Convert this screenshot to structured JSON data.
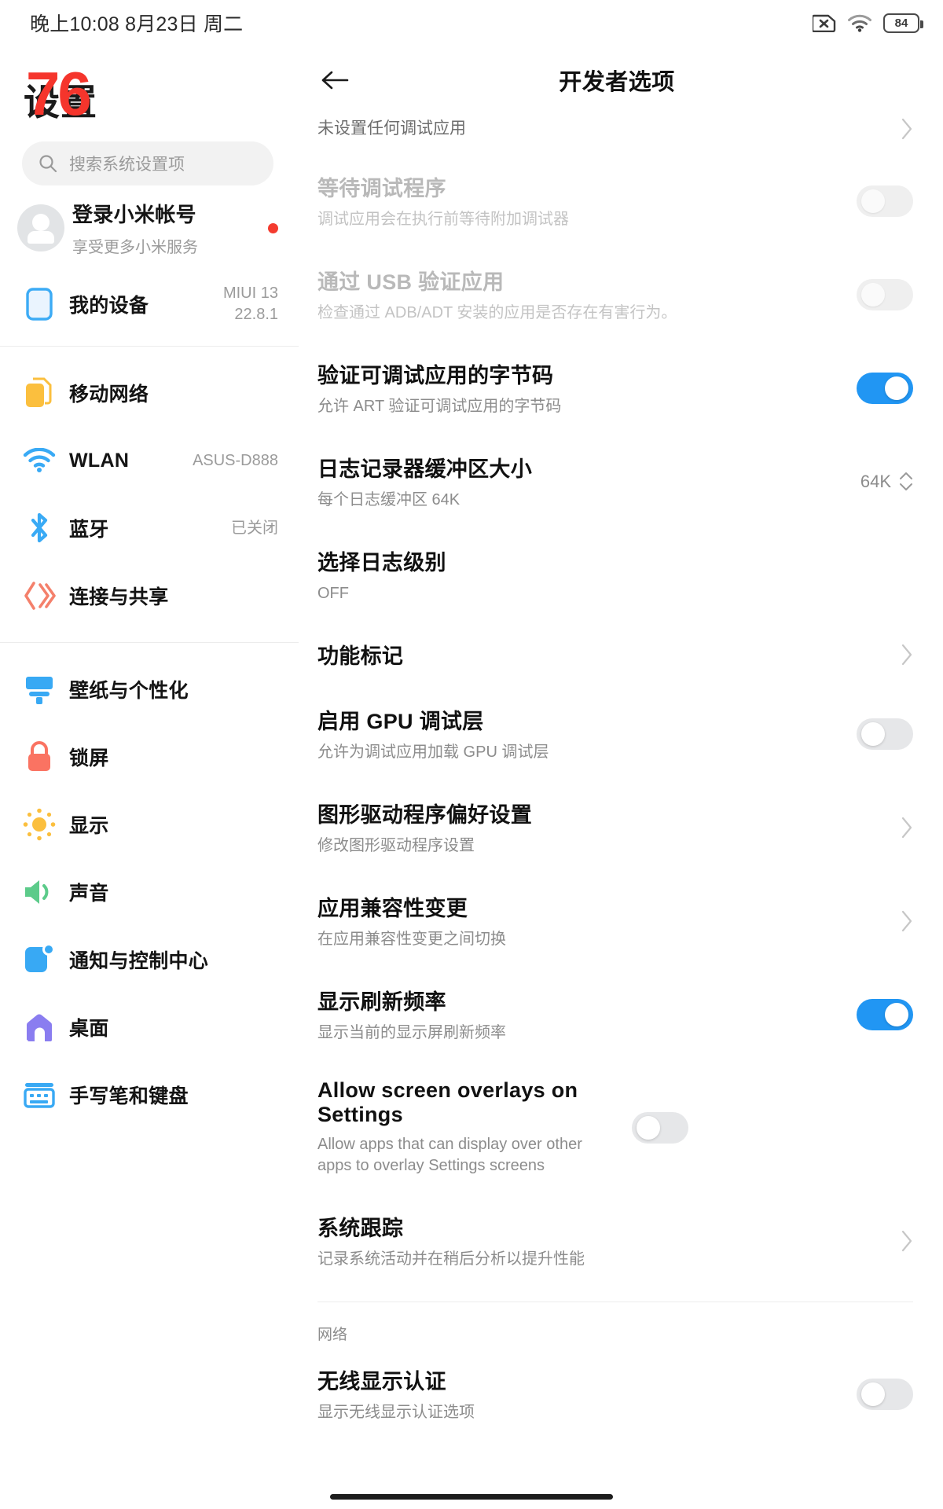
{
  "statusbar": {
    "time": "晚上10:08  8月23日 周二",
    "battery_percent": "84",
    "icons": [
      "sim-disabled-icon",
      "wifi-icon",
      "battery-icon"
    ]
  },
  "sidebar": {
    "app_title": "设置",
    "watermark": "76",
    "search": {
      "placeholder": "搜索系统设置项",
      "icon": "search-icon"
    },
    "account": {
      "title": "登录小米帐号",
      "subtitle": "享受更多小米服务",
      "avatar": "person-avatar-icon",
      "badge": true
    },
    "device": {
      "title": "我的设备",
      "value_line1": "MIUI 13",
      "value_line2": "22.8.1",
      "icon": "device-icon"
    },
    "groups": [
      {
        "items": [
          {
            "label": "移动网络",
            "value": "",
            "icon": "sim-card-icon",
            "color": "#fbbf3e"
          },
          {
            "label": "WLAN",
            "value": "ASUS-D888",
            "icon": "wifi-icon",
            "color": "#39aaf5"
          },
          {
            "label": "蓝牙",
            "value": "已关闭",
            "icon": "bluetooth-icon",
            "color": "#39aaf5"
          },
          {
            "label": "连接与共享",
            "value": "",
            "icon": "share-icon",
            "color": "#f4806b"
          }
        ]
      },
      {
        "items": [
          {
            "label": "壁纸与个性化",
            "value": "",
            "icon": "wallpaper-icon",
            "color": "#38a9f4"
          },
          {
            "label": "锁屏",
            "value": "",
            "icon": "lock-icon",
            "color": "#fa7362"
          },
          {
            "label": "显示",
            "value": "",
            "icon": "brightness-icon",
            "color": "#fbbf3e"
          },
          {
            "label": "声音",
            "value": "",
            "icon": "speaker-icon",
            "color": "#5ccb8a"
          },
          {
            "label": "通知与控制中心",
            "value": "",
            "icon": "notification-icon",
            "color": "#38a9f4"
          },
          {
            "label": "桌面",
            "value": "",
            "icon": "home-icon",
            "color": "#8a7df0"
          },
          {
            "label": "手写笔和键盘",
            "value": "",
            "icon": "keyboard-icon",
            "color": "#38a9f4"
          }
        ]
      }
    ]
  },
  "detail": {
    "title": "开发者选项",
    "back_icon": "arrow-left-icon",
    "items": [
      {
        "title": "",
        "subtitle": "未设置任何调试应用",
        "control": "chevron",
        "dim": false,
        "clipped_top": true
      },
      {
        "title": "等待调试程序",
        "subtitle": "调试应用会在执行前等待附加调试器",
        "control": "switch",
        "switch_on": false,
        "dim": true
      },
      {
        "title": "通过 USB 验证应用",
        "subtitle": "检查通过 ADB/ADT 安装的应用是否存在有害行为。",
        "control": "switch",
        "switch_on": false,
        "dim": true
      },
      {
        "title": "验证可调试应用的字节码",
        "subtitle": "允许 ART 验证可调试应用的字节码",
        "control": "switch",
        "switch_on": true,
        "dim": false
      },
      {
        "title": "日志记录器缓冲区大小",
        "subtitle": "每个日志缓冲区 64K",
        "control": "stepper",
        "value": "64K",
        "dim": false
      },
      {
        "title": "选择日志级别",
        "subtitle": "OFF",
        "control": "none",
        "dim": false
      },
      {
        "title": "功能标记",
        "subtitle": "",
        "control": "chevron",
        "dim": false
      },
      {
        "title": "启用 GPU 调试层",
        "subtitle": "允许为调试应用加载 GPU 调试层",
        "control": "switch",
        "switch_on": false,
        "dim": false
      },
      {
        "title": "图形驱动程序偏好设置",
        "subtitle": "修改图形驱动程序设置",
        "control": "chevron",
        "dim": false
      },
      {
        "title": "应用兼容性变更",
        "subtitle": "在应用兼容性变更之间切换",
        "control": "chevron",
        "dim": false
      },
      {
        "title": "显示刷新频率",
        "subtitle": "显示当前的显示屏刷新频率",
        "control": "switch",
        "switch_on": true,
        "dim": false
      },
      {
        "title": "Allow screen overlays on Settings",
        "subtitle": "Allow apps that can display over other apps to overlay Settings screens",
        "control": "switch",
        "switch_on": false,
        "dim": false
      },
      {
        "title": "系统跟踪",
        "subtitle": "记录系统活动并在稍后分析以提升性能",
        "control": "chevron",
        "dim": false
      }
    ],
    "section_label": "网络",
    "section_items": [
      {
        "title": "无线显示认证",
        "subtitle": "显示无线显示认证选项",
        "control": "switch",
        "switch_on": false,
        "dim": false
      }
    ]
  },
  "colors": {
    "accent_blue": "#2196f3",
    "red_watermark": "#f5352c",
    "badge_red": "#f43b2f"
  }
}
